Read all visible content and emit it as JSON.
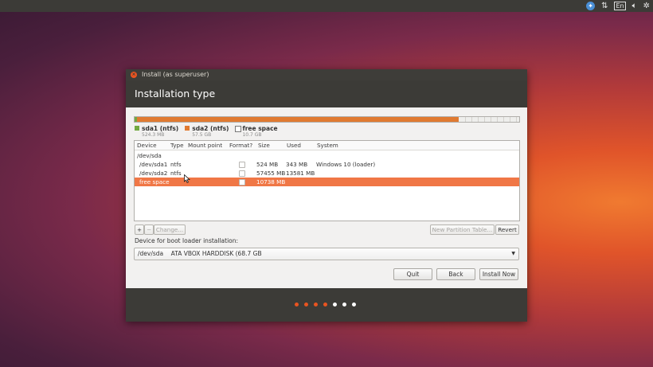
{
  "tray": {
    "accessibility_icon": "accessibility-icon",
    "network_icon": "network-arrows-icon",
    "keyboard_label": "En",
    "volume_icon": "volume-icon",
    "settings_icon": "gear-icon"
  },
  "window": {
    "title": "Install (as superuser)",
    "heading": "Installation type"
  },
  "partition_bar": {
    "segments": [
      {
        "name": "sda1",
        "fraction": 0.006,
        "color": "#73a941"
      },
      {
        "name": "sda2",
        "fraction": 0.836,
        "color": "#e07a31"
      },
      {
        "name": "free space",
        "fraction": 0.158,
        "color": "#eeeeec"
      }
    ]
  },
  "legend": [
    {
      "name": "sda1 (ntfs)",
      "size": "524.3 MB",
      "color": "#73a941"
    },
    {
      "name": "sda2 (ntfs)",
      "size": "57.5 GB",
      "color": "#e07a31"
    },
    {
      "name": "free space",
      "size": "10.7 GB",
      "color": "#ffffff"
    }
  ],
  "table": {
    "headers": {
      "device": "Device",
      "type": "Type",
      "mount": "Mount point",
      "format": "Format?",
      "size": "Size",
      "used": "Used",
      "system": "System"
    },
    "rows": [
      {
        "device": "/dev/sda",
        "type": "",
        "mount": "",
        "size": "",
        "used": "",
        "system": ""
      },
      {
        "device": "/dev/sda1",
        "type": "ntfs",
        "mount": "",
        "size": "524 MB",
        "used": "343 MB",
        "system": "Windows 10 (loader)"
      },
      {
        "device": "/dev/sda2",
        "type": "ntfs",
        "mount": "",
        "size": "57455 MB",
        "used": "13581 MB",
        "system": ""
      },
      {
        "device": "free space",
        "type": "",
        "mount": "",
        "size": "10738 MB",
        "used": "",
        "system": ""
      }
    ]
  },
  "toolbar": {
    "add": "+",
    "remove": "−",
    "change": "Change...",
    "new_table": "New Partition Table...",
    "revert": "Revert"
  },
  "boot_loader": {
    "label": "Device for boot loader installation:",
    "value": "/dev/sda    ATA VBOX HARDDISK (68.7 GB"
  },
  "buttons": {
    "quit": "Quit",
    "back": "Back",
    "install": "Install Now"
  },
  "progress": {
    "total_steps": 7,
    "completed_steps": 4,
    "active_color": "#e95420",
    "inactive_color": "#ffffff"
  }
}
